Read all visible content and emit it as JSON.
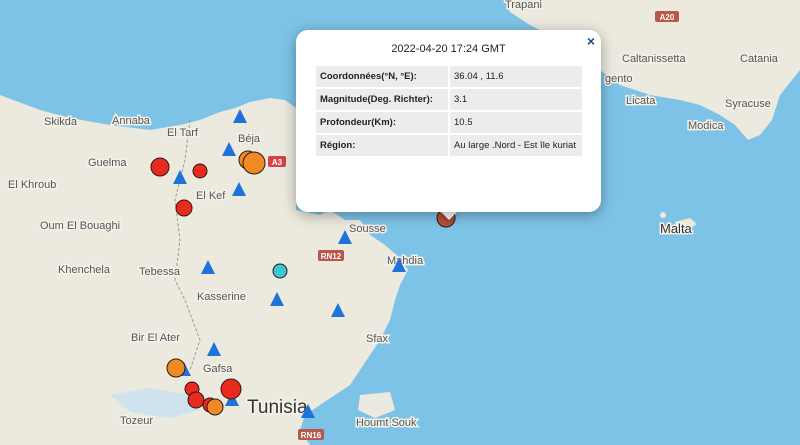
{
  "map": {
    "country_label": "Tunisia",
    "labels": [
      {
        "key": "trapani",
        "text": "Trapani"
      },
      {
        "key": "caltanissetta",
        "text": "Caltanissetta"
      },
      {
        "key": "catania",
        "text": "Catania"
      },
      {
        "key": "gento",
        "text": "gento"
      },
      {
        "key": "licata",
        "text": "Licata"
      },
      {
        "key": "syracuse",
        "text": "Syracuse"
      },
      {
        "key": "modica",
        "text": "Modica"
      },
      {
        "key": "malta",
        "text": "Malta"
      },
      {
        "key": "skikda",
        "text": "Skikda"
      },
      {
        "key": "annaba",
        "text": "Annaba"
      },
      {
        "key": "eltarf",
        "text": "El Tarf"
      },
      {
        "key": "beja",
        "text": "Béja"
      },
      {
        "key": "guelma",
        "text": "Guelma"
      },
      {
        "key": "elkhroub",
        "text": "El Khroub"
      },
      {
        "key": "elkef",
        "text": "El Kef"
      },
      {
        "key": "oumelbouaghi",
        "text": "Oum El Bouaghi"
      },
      {
        "key": "khenchela",
        "text": "Khenchela"
      },
      {
        "key": "tebessa",
        "text": "Tebessa"
      },
      {
        "key": "sousse",
        "text": "Sousse"
      },
      {
        "key": "mahdia",
        "text": "Mahdia"
      },
      {
        "key": "kasserine",
        "text": "Kasserine"
      },
      {
        "key": "biralater",
        "text": "Bir El Ater"
      },
      {
        "key": "sfax",
        "text": "Sfax"
      },
      {
        "key": "gafsa",
        "text": "Gafsa"
      },
      {
        "key": "tozeur",
        "text": "Tozeur"
      },
      {
        "key": "houmtsouk",
        "text": "Houmt Souk"
      }
    ],
    "roads": [
      {
        "key": "a20",
        "text": "A20"
      },
      {
        "key": "a3",
        "text": "A3"
      },
      {
        "key": "rn12",
        "text": "RN12"
      },
      {
        "key": "rn16",
        "text": "RN16"
      }
    ]
  },
  "popup": {
    "title": "2022-04-20 17:24 GMT",
    "close_symbol": "×",
    "rows": [
      {
        "label": "Coordonnées(°N, °E):",
        "value": "36.04 , 11.6"
      },
      {
        "label": "Magnitude(Deg. Richter):",
        "value": "3.1"
      },
      {
        "label": "Profondeur(Km):",
        "value": "10.5"
      },
      {
        "label": "Région:",
        "value": "Au large .Nord - Est île kuriat"
      }
    ]
  },
  "marker_colors": {
    "red": "#e82a1f",
    "orange": "#f08a24",
    "cyan": "#3cc6d6",
    "selected": "#b5503a",
    "station": "#1e73d8"
  }
}
